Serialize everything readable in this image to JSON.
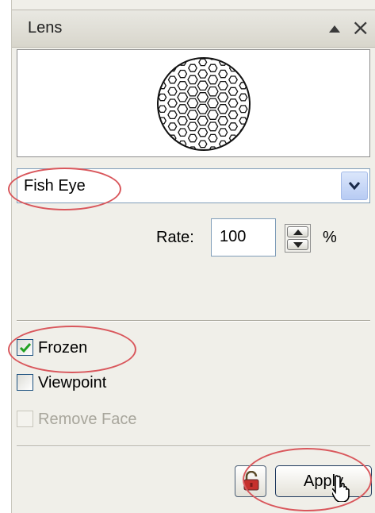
{
  "panel": {
    "title": "Lens",
    "collapse_icon": "triangle-up-icon",
    "close_icon": "close-icon"
  },
  "preview": {
    "icon": "fish-eye-sphere-icon"
  },
  "lens_type": {
    "selected": "Fish Eye"
  },
  "rate": {
    "label": "Rate:",
    "value": "100",
    "unit": "%"
  },
  "options": {
    "frozen": {
      "label": "Frozen",
      "checked": true
    },
    "viewpoint": {
      "label": "Viewpoint",
      "checked": false
    },
    "remove_face": {
      "label": "Remove Face",
      "checked": false,
      "disabled": true
    }
  },
  "actions": {
    "lock_icon": "lock-icon",
    "apply_label": "Apply"
  },
  "colors": {
    "highlight_ring": "#d9575c",
    "checkbox_border": "#1c5180",
    "checkmark": "#21a121"
  }
}
